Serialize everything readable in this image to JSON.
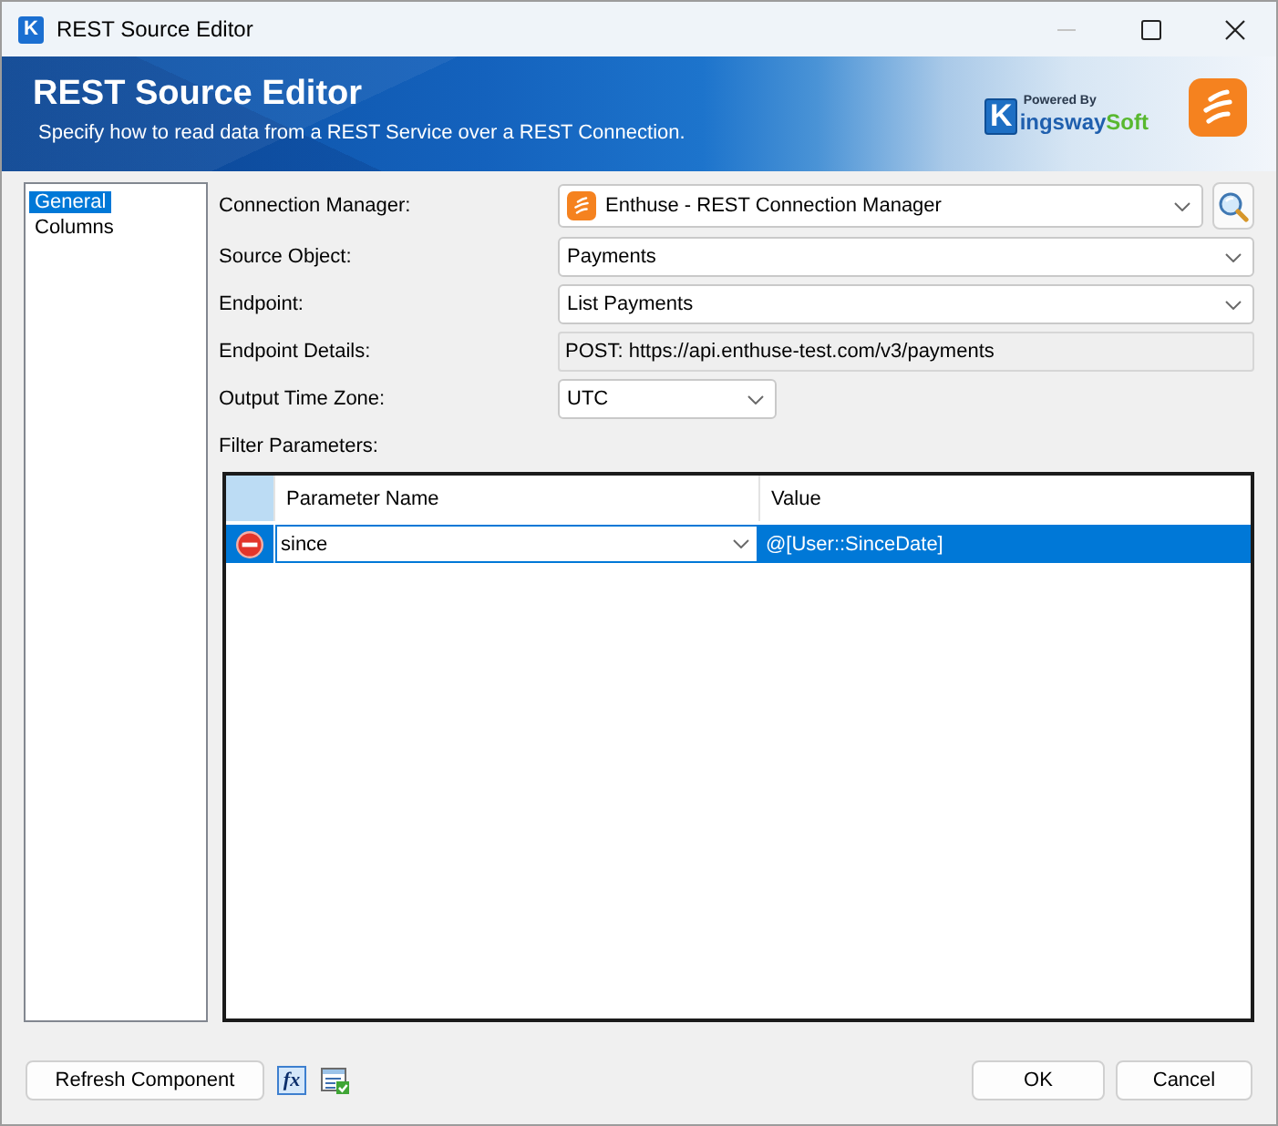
{
  "window": {
    "title": "REST Source Editor",
    "icon_letter": "K",
    "minimize_disabled": true
  },
  "header": {
    "title": "REST Source Editor",
    "subtitle": "Specify how to read data from a REST Service over a REST Connection.",
    "logo": {
      "tagline": "Powered By",
      "initial": "K",
      "name": "ingsway",
      "suffix": "Soft"
    }
  },
  "nav": [
    {
      "label": "General",
      "selected": true
    },
    {
      "label": "Columns",
      "selected": false
    }
  ],
  "fields": [
    {
      "label": "Connection Manager:",
      "kind": "connection",
      "value": "Enthuse - REST Connection Manager"
    },
    {
      "label": "Source Object:",
      "kind": "combo",
      "value": "Payments"
    },
    {
      "label": "Endpoint:",
      "kind": "combo",
      "value": "List Payments"
    },
    {
      "label": "Endpoint Details:",
      "kind": "readonly",
      "value": "POST: https://api.enthuse-test.com/v3/payments"
    },
    {
      "label": "Output Time Zone:",
      "kind": "short_combo",
      "value": "UTC"
    }
  ],
  "filter_parameters": {
    "label": "Filter Parameters:",
    "columns": [
      "Parameter Name",
      "Value"
    ],
    "rows": [
      {
        "name": "since",
        "value": "@[User::SinceDate]",
        "selected": true,
        "editing": true
      }
    ]
  },
  "footer": {
    "refresh_button": "Refresh Component",
    "expression_button": "fx",
    "ok_button": "OK",
    "cancel_button": "Cancel"
  }
}
